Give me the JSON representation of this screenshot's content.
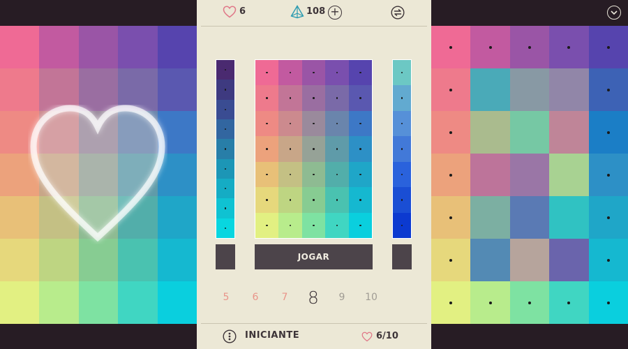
{
  "top_bar": {
    "lives": "6",
    "gems": "108",
    "add_gems_symbol": "+"
  },
  "icons": {
    "lives": "heart-outline-icon",
    "gems": "prism-icon",
    "add": "plus-circle-icon",
    "settings": "swap-arrows-icon",
    "collapse": "chevron-down-icon",
    "difficulty": "dice-icon",
    "progress": "heart-outline-icon"
  },
  "colors": {
    "accent": "#e99489",
    "panel_bg": "#ece8d6",
    "dark": "#3d3438",
    "button_bg": "#4c444a"
  },
  "play_button": {
    "label": "JOGAR"
  },
  "levels": [
    {
      "label": "5",
      "state": "done"
    },
    {
      "label": "6",
      "state": "done"
    },
    {
      "label": "7",
      "state": "done"
    },
    {
      "label": "8",
      "state": "current"
    },
    {
      "label": "9",
      "state": "todo"
    },
    {
      "label": "10",
      "state": "todo"
    }
  ],
  "footer": {
    "difficulty": "INICIANTE",
    "progress": "6/10"
  },
  "puzzle": {
    "left_grid": [
      [
        "#ef6a95",
        "#c25aa0",
        "#9a55a6",
        "#7a4fae",
        "#5644ae"
      ],
      [
        "#ee7a8c",
        "#c27597",
        "#9a6ea1",
        "#7a6aa8",
        "#5a58b0"
      ],
      [
        "#ee8a84",
        "#cc8a8e",
        "#9a8a9c",
        "#6a85ac",
        "#3d78c6"
      ],
      [
        "#eca27c",
        "#c8a688",
        "#96a297",
        "#5f9ba9",
        "#2d90c6"
      ],
      [
        "#e8c078",
        "#c4c084",
        "#8ebb92",
        "#52aeaa",
        "#1fa6c8"
      ],
      [
        "#e6d87c",
        "#bed582",
        "#87cc92",
        "#4ac2b0",
        "#15b8d0"
      ],
      [
        "#e2f082",
        "#b8ec8c",
        "#7ee2a2",
        "#40d6c2",
        "#0acfde"
      ]
    ],
    "right_grid": [
      [
        "#ef6a95",
        "#c25aa0",
        "#9a55a6",
        "#7a4fae",
        "#5644ae"
      ],
      [
        "#ee7a8c",
        "#4aaab8",
        "#8899a4",
        "#9186a8",
        "#3d62b5"
      ],
      [
        "#ee8a84",
        "#aabb8e",
        "#76c8a4",
        "#bf8598",
        "#1b7ec6"
      ],
      [
        "#eca27c",
        "#bd749a",
        "#9a76a6",
        "#a8d292",
        "#2d90c6"
      ],
      [
        "#e8c078",
        "#7cafa2",
        "#5a7ab4",
        "#30c2c2",
        "#1fa6c8"
      ],
      [
        "#e6d87c",
        "#538ab4",
        "#b6a49c",
        "#6a64ac",
        "#15b8d0"
      ],
      [
        "#e2f082",
        "#b8ec8c",
        "#7ee2a2",
        "#40d6c2",
        "#0acfde"
      ]
    ],
    "left_strip": [
      "#4a2a70",
      "#3e3a80",
      "#3a4c92",
      "#3266a0",
      "#287ea8",
      "#1c96b6",
      "#15acc4",
      "#0fc2d2",
      "#08d6e0"
    ],
    "right_strip": [
      "#6cc8c4",
      "#62aad0",
      "#5690d8",
      "#4279d8",
      "#2a62dc",
      "#1a4ed4",
      "#0c3ad0"
    ]
  }
}
